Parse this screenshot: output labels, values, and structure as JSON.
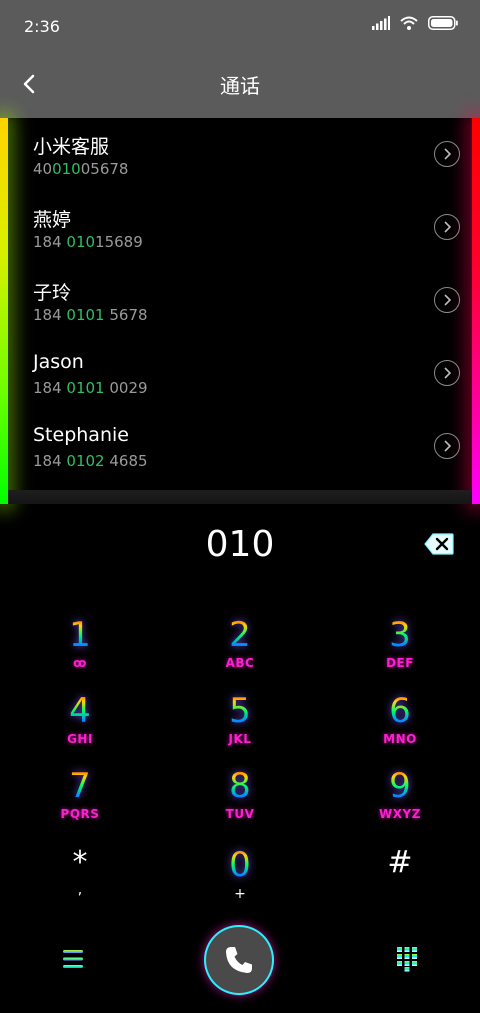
{
  "status": {
    "time": "2:36"
  },
  "header": {
    "title": "通话"
  },
  "contacts": [
    {
      "name": "小米客服",
      "number_pre": "40",
      "number_hl": "010",
      "number_post": "05678"
    },
    {
      "name": "燕婷",
      "number_pre": "184 ",
      "number_hl": "010",
      "number_post": "15689"
    },
    {
      "name": "子玲",
      "number_pre": "184 ",
      "number_hl": "0101",
      "number_post": " 5678"
    },
    {
      "name": "Jason",
      "number_pre": "184 ",
      "number_hl": "0101",
      "number_post": " 0029"
    },
    {
      "name": "Stephanie",
      "number_pre": "184 ",
      "number_hl": "0102",
      "number_post": " 4685"
    }
  ],
  "dialer": {
    "input": "010",
    "keys": [
      {
        "digit": "1",
        "letters": "ꝏ"
      },
      {
        "digit": "2",
        "letters": "ABC"
      },
      {
        "digit": "3",
        "letters": "DEF"
      },
      {
        "digit": "4",
        "letters": "GHI"
      },
      {
        "digit": "5",
        "letters": "JKL"
      },
      {
        "digit": "6",
        "letters": "MNO"
      },
      {
        "digit": "7",
        "letters": "PQRS"
      },
      {
        "digit": "8",
        "letters": "TUV"
      },
      {
        "digit": "9",
        "letters": "WXYZ"
      },
      {
        "digit": "*",
        "letters": ","
      },
      {
        "digit": "0",
        "letters": "+"
      },
      {
        "digit": "#",
        "letters": ""
      }
    ]
  },
  "colors": {
    "bar": "#5b5b5b",
    "match_highlight": "#2fbf63",
    "letters": "#ff1fd2"
  },
  "icons": {
    "back": "chevron-left-icon",
    "row": "chevron-right-circle-icon",
    "backspace": "backspace-icon",
    "menu": "menu-icon",
    "call": "phone-icon",
    "keypad": "keypad-icon"
  }
}
